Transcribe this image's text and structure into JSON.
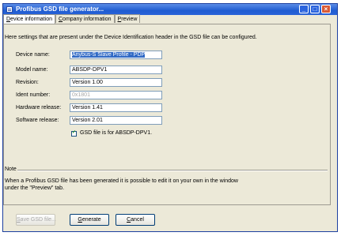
{
  "window": {
    "title": "Profibus GSD file generator..."
  },
  "tabs": [
    {
      "pre": "",
      "key": "D",
      "post": "evice information"
    },
    {
      "pre": "",
      "key": "C",
      "post": "ompany information"
    },
    {
      "pre": "",
      "key": "P",
      "post": "review"
    }
  ],
  "description": "Here settings that are present under the Device Identification header in the GSD file can be configured.",
  "fields": [
    {
      "label": "Device name:",
      "value": "Anybus-S Slave Profile - PDP"
    },
    {
      "label": "Model name:",
      "value": "ABSDP-DPV1"
    },
    {
      "label": "Revision:",
      "value": "Version 1.00"
    },
    {
      "label": "Ident number:",
      "value": "0x1801"
    },
    {
      "label": "Hardware release:",
      "value": "Version 1.41"
    },
    {
      "label": "Software release:",
      "value": "Version 2.01"
    }
  ],
  "checkbox": {
    "label": "GSD file is for ABSDP-DPV1.",
    "checked": true
  },
  "note": {
    "label": "Note",
    "text": "When a Profibus GSD file has been generated it is possible to edit it on your own in the window under the \"Preview\" tab."
  },
  "buttons": [
    {
      "pre": "",
      "key": "S",
      "post": "ave GSD file..."
    },
    {
      "pre": "",
      "key": "G",
      "post": "enerate"
    },
    {
      "pre": "",
      "key": "C",
      "post": "ancel"
    }
  ]
}
